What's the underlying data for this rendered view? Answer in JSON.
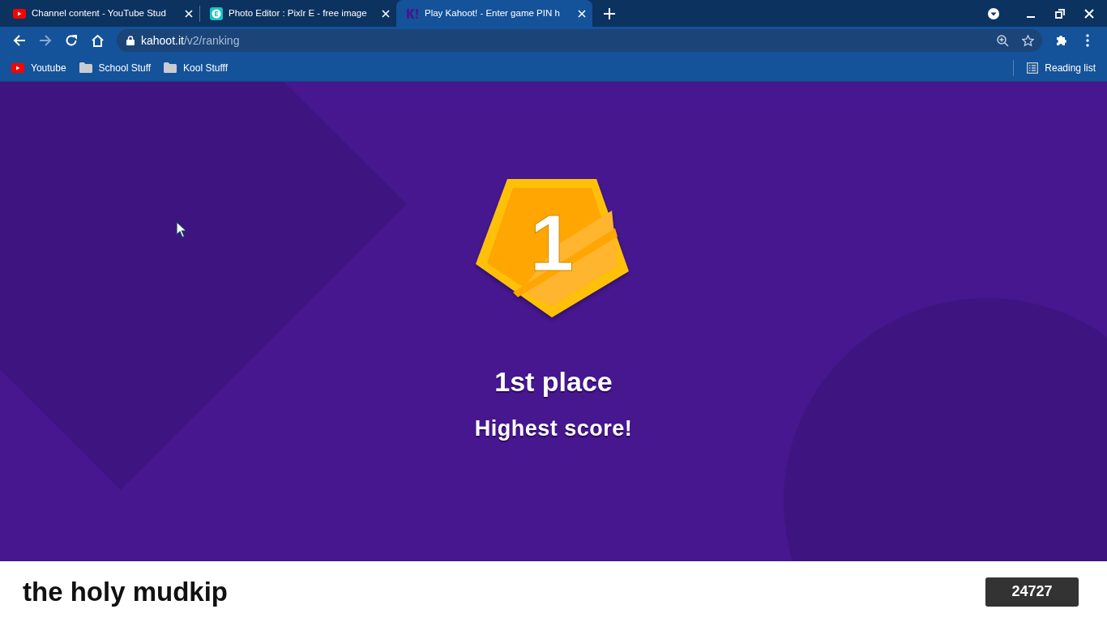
{
  "browser": {
    "tabs": [
      {
        "title": "Channel content - YouTube Stud",
        "kind": "youtube",
        "selected": false
      },
      {
        "title": "Photo Editor : Pixlr E - free image",
        "kind": "pixlr",
        "selected": false
      },
      {
        "title": "Play Kahoot! - Enter game PIN h",
        "kind": "kahoot",
        "selected": true
      }
    ],
    "address": {
      "host": "kahoot.it",
      "path": "/v2/ranking"
    },
    "bookmarks": [
      {
        "label": "Youtube",
        "kind": "youtube"
      },
      {
        "label": "School Stuff",
        "kind": "folder"
      },
      {
        "label": "Kool Stufff",
        "kind": "folder"
      }
    ],
    "reading_list": "Reading list"
  },
  "result": {
    "rank": "1",
    "place": "1st place",
    "message": "Highest score!"
  },
  "player": {
    "name": "the holy mudkip",
    "score": "24727"
  }
}
